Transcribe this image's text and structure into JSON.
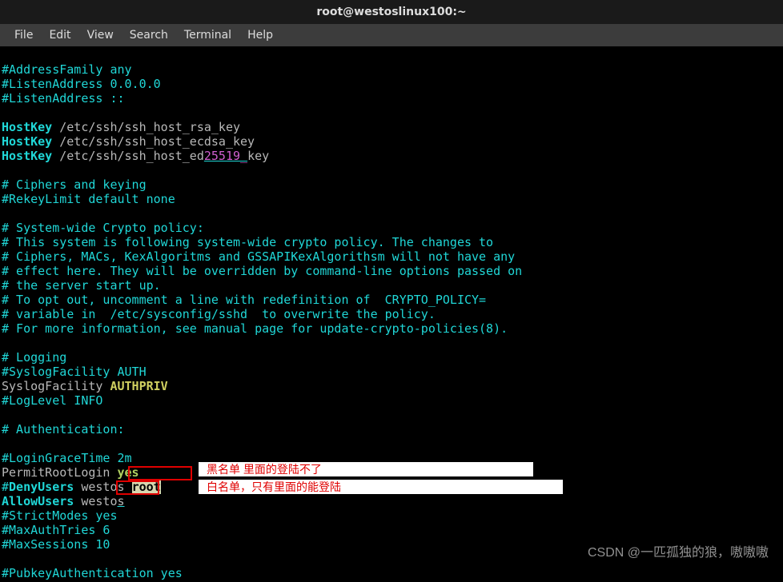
{
  "window": {
    "title": "root@westoslinux100:~"
  },
  "menu": {
    "file": "File",
    "edit": "Edit",
    "view": "View",
    "search": "Search",
    "terminal": "Terminal",
    "help": "Help"
  },
  "lines": {
    "l1": "#AddressFamily any",
    "l2": "#ListenAddress 0.0.0.0",
    "l3": "#ListenAddress ::",
    "hk": "HostKey",
    "hk1": " /etc/ssh/ssh_host_rsa_key",
    "hk2": " /etc/ssh/ssh_host_ecdsa_key",
    "hk3a": " /etc/ssh/ssh_host_ed",
    "hk3num": "25519_",
    "hk3b": "key",
    "cip": "# Ciphers and keying",
    "rek": "#RekeyLimit default none",
    "sc1": "# System-wide Crypto policy:",
    "sc2": "# This system is following system-wide crypto policy. The changes to",
    "sc3": "# Ciphers, MACs, KexAlgoritms and GSSAPIKexAlgorithsm will not have any",
    "sc4": "# effect here. They will be overridden by command-line options passed on",
    "sc5": "# the server start up.",
    "sc6": "# To opt out, uncomment a line with redefinition of  CRYPTO_POLICY=",
    "sc7": "# variable in  /etc/sysconfig/sshd  to overwrite the policy.",
    "sc8": "# For more information, see manual page for update-crypto-policies(8).",
    "log": "# Logging",
    "syslogc": "#SyslogFacility AUTH",
    "syslog_k": "SyslogFacility ",
    "syslog_v": "AUTHPRIV",
    "loglevel": "#LogLevel INFO",
    "auth": "# Authentication:",
    "logingrace": "#LoginGraceTime 2m",
    "permitroot_k": "PermitRootLogin ",
    "permitroot_v": "yes",
    "deny_hash": "#",
    "deny_key": "DenyUsers",
    "deny_val": " westos ",
    "deny_root": "root",
    "allow_key": "AllowUsers",
    "allow_val1": " westo",
    "allow_val2": "s",
    "strict": "#StrictModes yes",
    "maxauth": "#MaxAuthTries 6",
    "maxsess": "#MaxSessions 10",
    "pubkey": "#PubkeyAuthentication yes"
  },
  "annotations": {
    "blacklist": "黑名单 里面的登陆不了",
    "whitelist": "白名单，只有里面的能登陆"
  },
  "watermark": "CSDN @一匹孤独的狼，嗷嗷嗷"
}
